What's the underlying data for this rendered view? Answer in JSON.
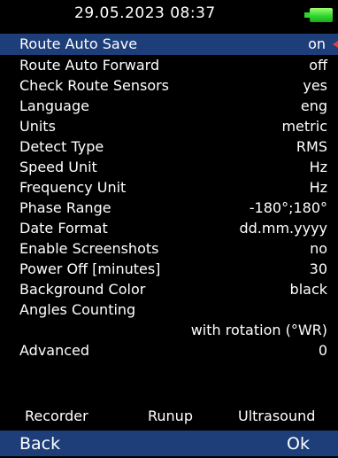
{
  "header": {
    "datetime": "29.05.2023 08:37",
    "battery_icon": "battery-full-icon"
  },
  "settings": [
    {
      "label": "Route Auto Save",
      "value": "on"
    },
    {
      "label": "Route Auto Forward",
      "value": "off"
    },
    {
      "label": "Check Route Sensors",
      "value": "yes"
    },
    {
      "label": "Language",
      "value": "eng"
    },
    {
      "label": "Units",
      "value": "metric"
    },
    {
      "label": "Detect Type",
      "value": "RMS"
    },
    {
      "label": "Speed Unit",
      "value": "Hz"
    },
    {
      "label": "Frequency Unit",
      "value": "Hz"
    },
    {
      "label": "Phase Range",
      "value": "-180°;180°"
    },
    {
      "label": "Date Format",
      "value": "dd.mm.yyyy"
    },
    {
      "label": "Enable Screenshots",
      "value": "no"
    },
    {
      "label": "Power Off [minutes]",
      "value": "30"
    },
    {
      "label": "Background Color",
      "value": "black"
    },
    {
      "label": "Angles Counting",
      "value": ""
    },
    {
      "label": "",
      "value": "with rotation (°WR)"
    },
    {
      "label": "Advanced",
      "value": "0"
    }
  ],
  "function_keys": {
    "f1": "Recorder",
    "f2": "Runup",
    "f3": "Ultrasound"
  },
  "nav": {
    "back_label": "Back",
    "ok_label": "Ok"
  },
  "colors": {
    "selection": "#1d3e79",
    "background": "#000000",
    "text": "#ffffff",
    "battery": "#2cd42c",
    "cursor_marker": "#e23b3b"
  }
}
